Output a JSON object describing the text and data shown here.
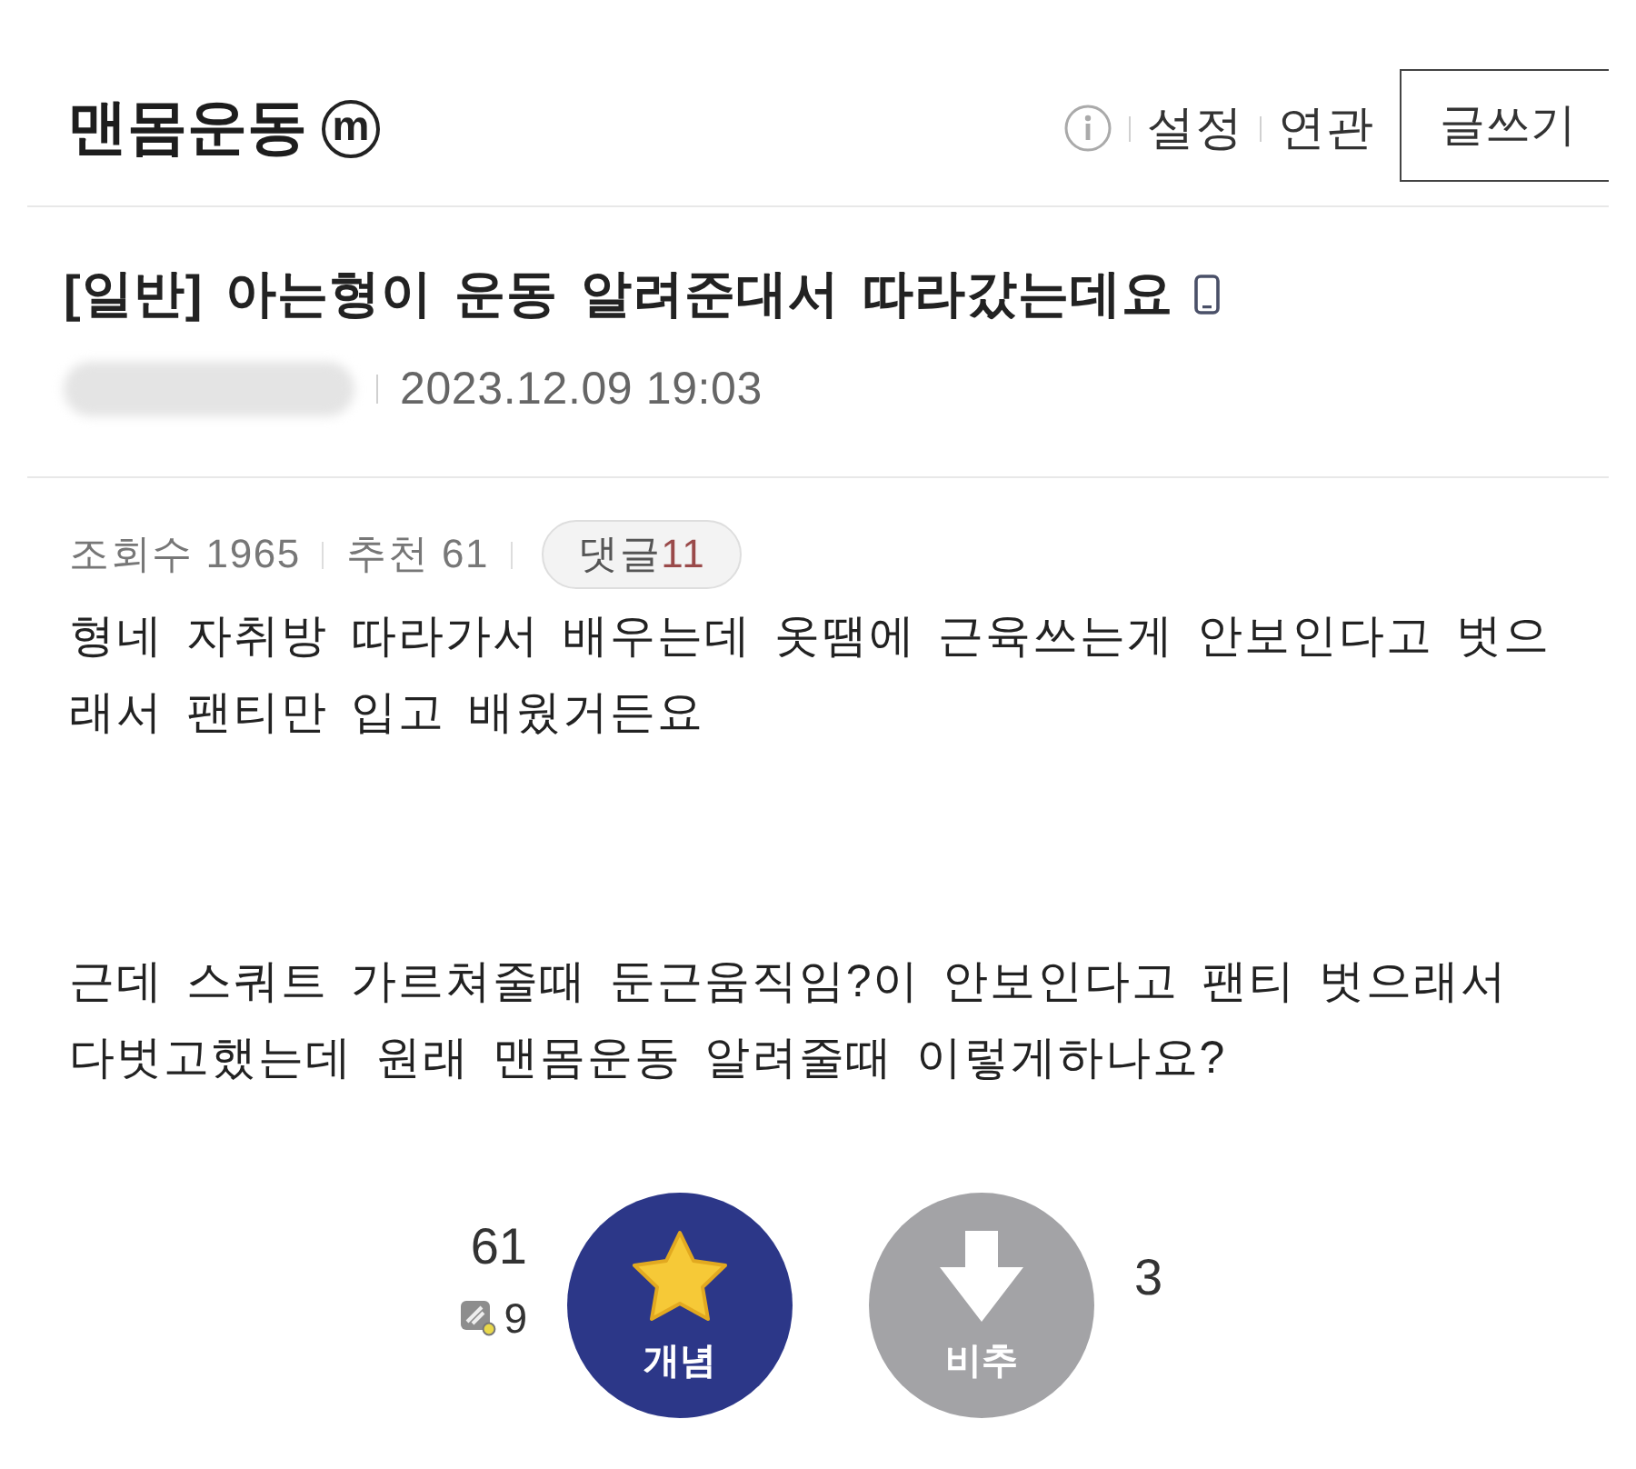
{
  "header": {
    "title": "맨몸운동",
    "mark": "m",
    "links": [
      "설정",
      "연관"
    ],
    "write_button": "글쓰기"
  },
  "post": {
    "title": "[일반] 아는형이 운동 알려준대서 따라갔는데요",
    "date": "2023.12.09 19:03"
  },
  "stats": {
    "items": [
      "조회수 1965",
      "추천 61"
    ],
    "comments": {
      "label": "댓글",
      "count": "11"
    }
  },
  "body": [
    "형네 자취방 따라가서 배우는데 옷땜에 근육쓰는게 안보인다고 벗으래서 팬티만 입고 배웠거든요",
    "근데 스쿼트 가르쳐줄때 둔근움직임?이 안보인다고 팬티 벗으래서 다벗고했는데 원래 맨몸운동 알려줄때 이렇게하나요?"
  ],
  "votes": {
    "up": {
      "label": "개념",
      "count": "61",
      "sub_count": "9"
    },
    "down": {
      "label": "비추",
      "count": "3"
    }
  }
}
